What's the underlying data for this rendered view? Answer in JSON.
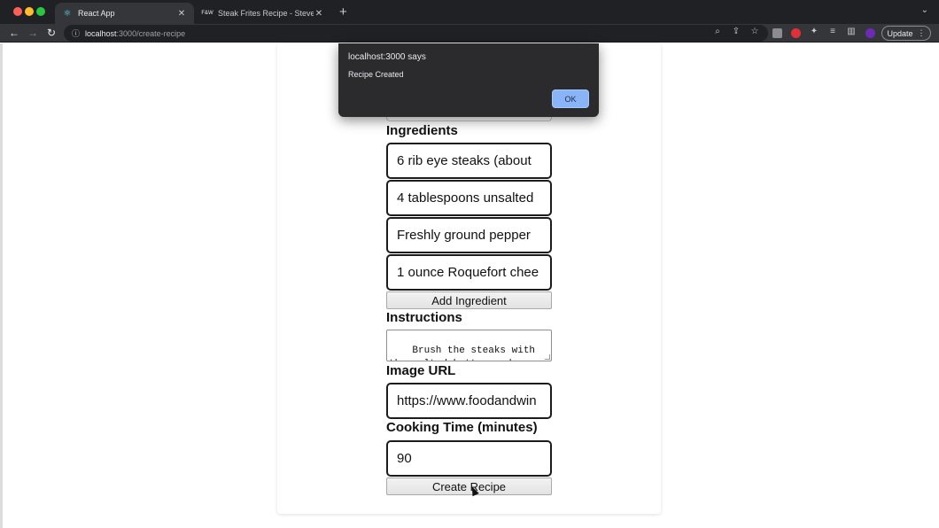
{
  "browser": {
    "tabs": [
      {
        "label": "React App",
        "active": true
      },
      {
        "label": "Steak Frites Recipe - Steven R",
        "active": false
      }
    ],
    "url_host": "localhost",
    "url_path": ":3000/create-recipe",
    "update_label": "Update"
  },
  "dialog": {
    "title": "localhost:3000 says",
    "message": "Recipe Created",
    "ok_label": "OK"
  },
  "form": {
    "ingredients_label": "Ingredients",
    "ingredients": [
      "6 rib eye steaks (about",
      "4 tablespoons unsalted",
      "Freshly ground pepper",
      "1 ounce Roquefort chee"
    ],
    "add_ingredient_label": "Add Ingredient",
    "instructions_label": "Instructions",
    "instructions_value": "Brush the steaks with\nthe melted butter and\nseason with salt and",
    "image_url_label": "Image URL",
    "image_url_value": "https://www.foodandwin",
    "cooking_time_label": "Cooking Time (minutes)",
    "cooking_time_value": "90",
    "submit_label": "Create Recipe"
  }
}
